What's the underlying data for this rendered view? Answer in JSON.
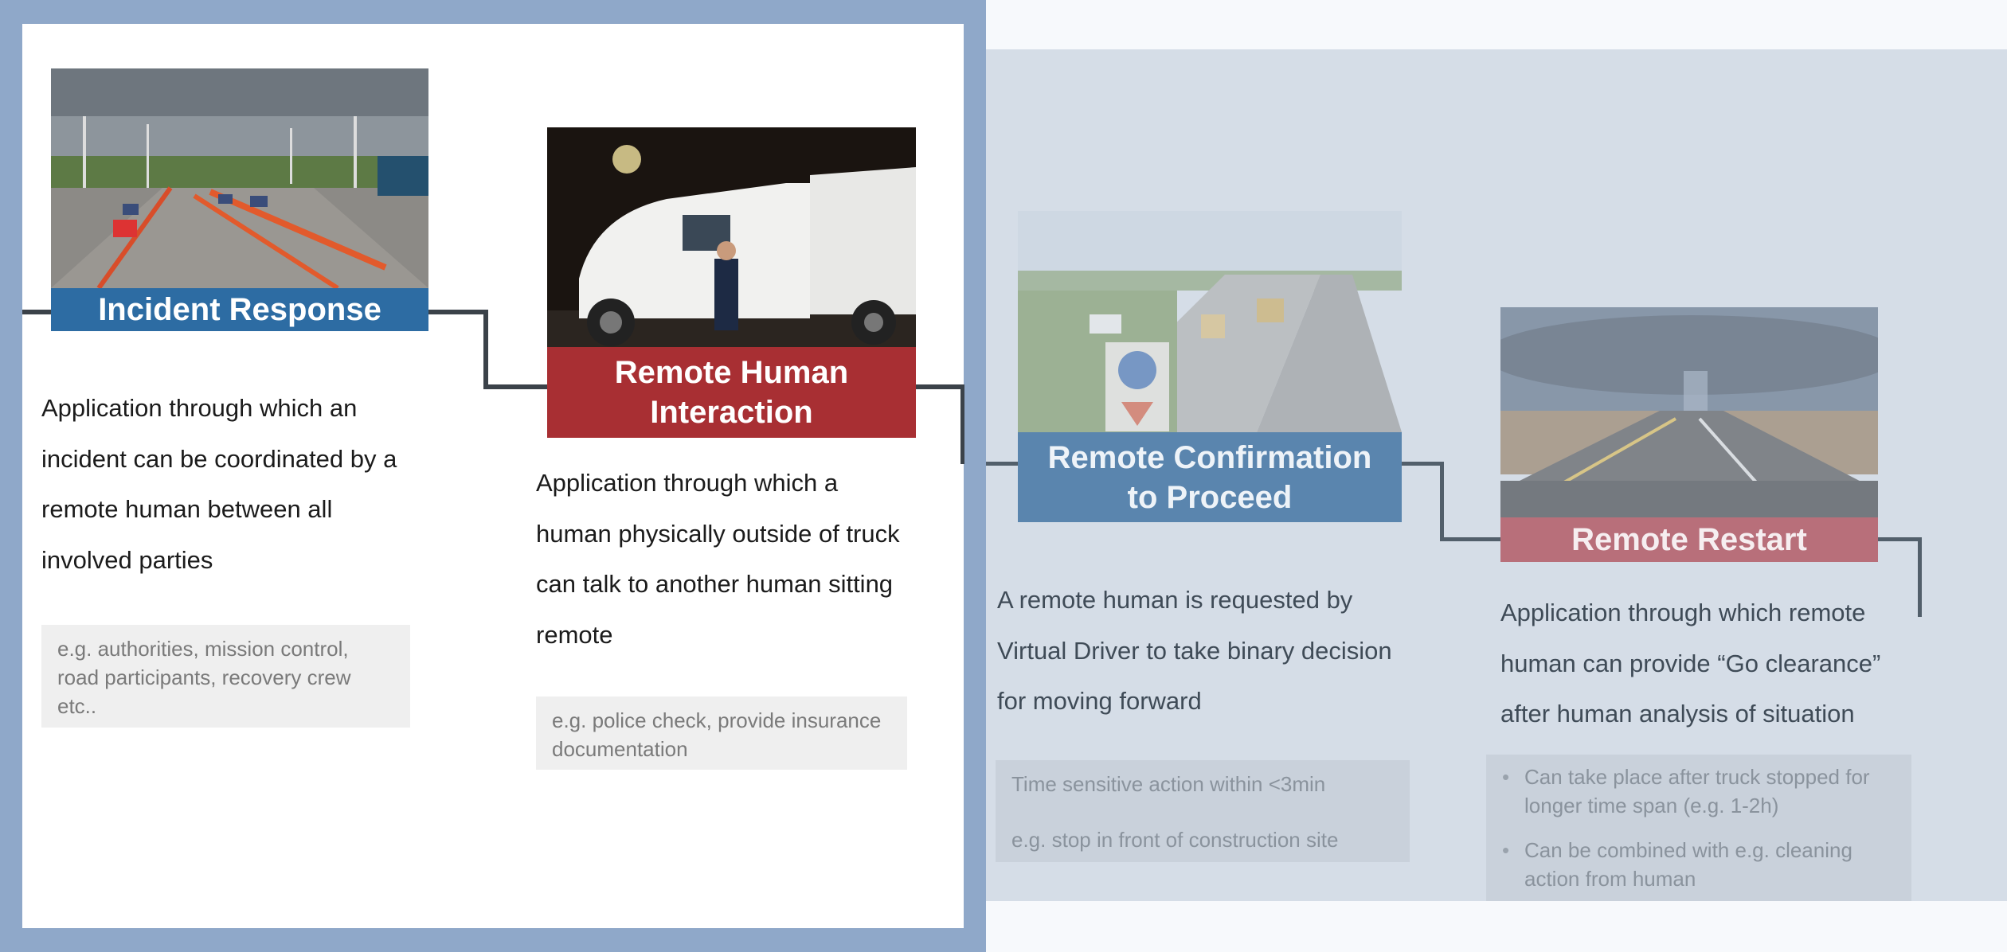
{
  "cards": [
    {
      "title": "Incident Response",
      "description": "Application through which an\nincident can be coordinated by  a\nremote human between all\ninvolved parties",
      "note": "e.g. authorities, mission control, road participants, recovery crew etc..",
      "image": "highway-incident-cones-photo"
    },
    {
      "title": "Remote Human\nInteraction",
      "description": "Application through which a\nhuman physically outside of truck\ncan talk to another human sitting\nremote",
      "note": "e.g. police check, provide insurance documentation",
      "image": "truck-police-check-night-photo"
    },
    {
      "title": "Remote Confirmation\nto Proceed",
      "description": "A remote human is requested by\nVirtual Driver to take binary decision\nfor moving forward",
      "note_lines": [
        "Time sensitive action within <3min",
        "e.g. stop in front of construction site"
      ],
      "image": "construction-site-highway-photo"
    },
    {
      "title": "Remote Restart",
      "description": "Application through which remote\nhuman can provide “Go clearance”\nafter human analysis of situation",
      "note_bullets": [
        "Can take place after truck stopped for longer time span (e.g. 1-2h)",
        "Can be combined with e.g. cleaning action from human"
      ],
      "image": "open-road-storm-windshield-photo"
    }
  ],
  "colors": {
    "frame": "#8fa8c9",
    "label_blue": "#2d6ca3",
    "label_red": "#a82f33",
    "faded_panel": "#d5dde7"
  }
}
